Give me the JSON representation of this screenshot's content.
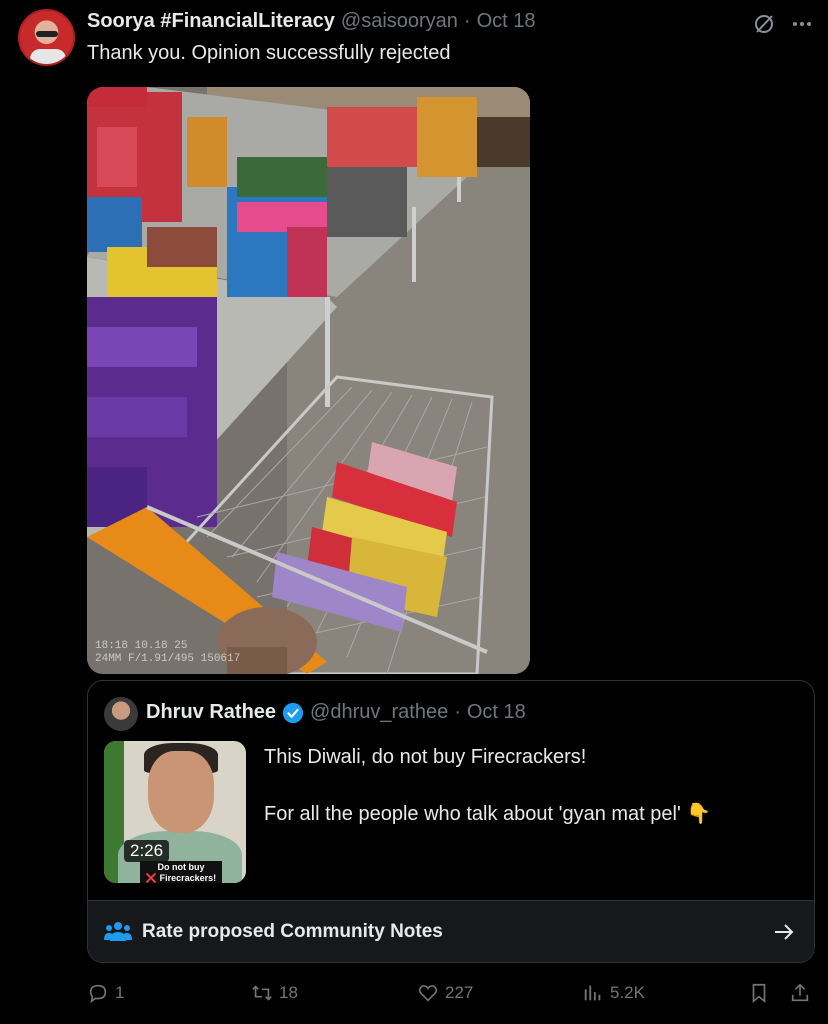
{
  "post": {
    "author_name": "Soorya #FinancialLiteracy",
    "handle": "@saisooryan",
    "separator": "·",
    "date": "Oct 18",
    "text": "Thank you. Opinion successfully rejected",
    "photo_stamp_line1": "18:18 10.18 25",
    "photo_stamp_line2": "24MM F/1.91/495 150617"
  },
  "quoted": {
    "author_name": "Dhruv Rathee",
    "handle": "@dhruv_rathee",
    "separator": "·",
    "date": "Oct 18",
    "video_duration": "2:26",
    "video_caption_line1": "Do not buy",
    "video_caption_line2": "❌ Firecrackers! ❌",
    "text_line1": "This Diwali, do not buy Firecrackers!",
    "text_line2": "For all the people who talk about 'gyan mat pel' 👇",
    "notes_label": "Rate proposed Community Notes"
  },
  "actions": {
    "replies": "1",
    "reposts": "18",
    "likes": "227",
    "views": "5.2K"
  },
  "colors": {
    "background": "#000000",
    "text_primary": "#e7e9ea",
    "text_secondary": "#71767b",
    "accent_blue": "#1d9bf0",
    "border": "#2f3336"
  }
}
